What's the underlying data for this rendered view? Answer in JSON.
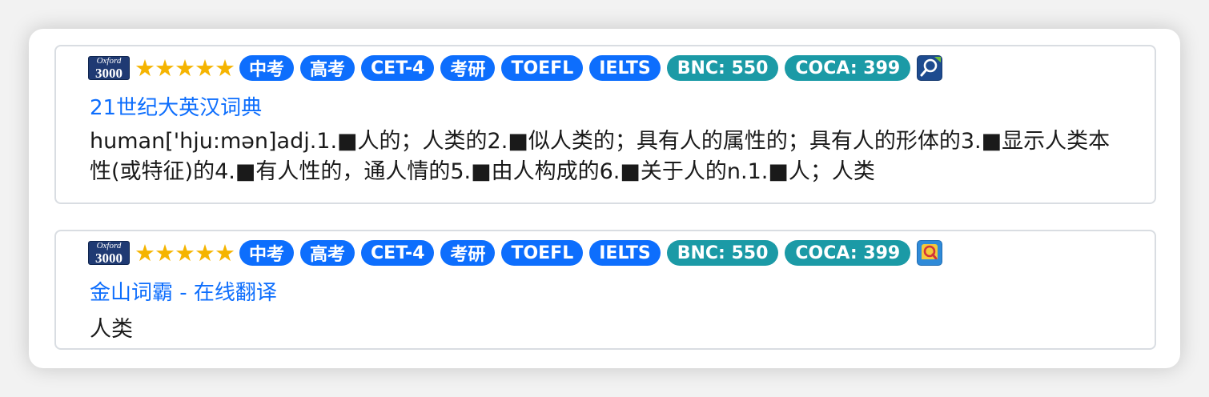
{
  "entries": [
    {
      "rank_badge": "Oxford 3000",
      "rank_badge_line1": "Oxford",
      "rank_badge_line2": "3000",
      "stars": "★★★★★",
      "rating": 5,
      "tags": [
        {
          "label": "中考",
          "color": "#0d6efd"
        },
        {
          "label": "高考",
          "color": "#0d6efd"
        },
        {
          "label": "CET-4",
          "color": "#0d6efd"
        },
        {
          "label": "考研",
          "color": "#0d6efd"
        },
        {
          "label": "TOEFL",
          "color": "#0d6efd"
        },
        {
          "label": "IELTS",
          "color": "#0d6efd"
        },
        {
          "label": "BNC: 550",
          "color": "#1b9aa6"
        },
        {
          "label": "COCA: 399",
          "color": "#1b9aa6"
        }
      ],
      "dict_icon": "magnifier-dictionary-icon",
      "source": "21世纪大英汉词典",
      "definition": "human['hju:mən]adj.1.■人的；人类的2.■似人类的；具有人的属性的；具有人的形体的3.■显示人类本性(或特征)的4.■有人性的，通人情的5.■由人构成的6.■关于人的n.1.■人；人类"
    },
    {
      "rank_badge": "Oxford 3000",
      "rank_badge_line1": "Oxford",
      "rank_badge_line2": "3000",
      "stars": "★★★★★",
      "rating": 5,
      "tags": [
        {
          "label": "中考",
          "color": "#0d6efd"
        },
        {
          "label": "高考",
          "color": "#0d6efd"
        },
        {
          "label": "CET-4",
          "color": "#0d6efd"
        },
        {
          "label": "考研",
          "color": "#0d6efd"
        },
        {
          "label": "TOEFL",
          "color": "#0d6efd"
        },
        {
          "label": "IELTS",
          "color": "#0d6efd"
        },
        {
          "label": "BNC: 550",
          "color": "#1b9aa6"
        },
        {
          "label": "COCA: 399",
          "color": "#1b9aa6"
        }
      ],
      "dict_icon": "iciba-translate-icon",
      "source": "金山词霸 - 在线翻译",
      "definition": "人类"
    }
  ]
}
